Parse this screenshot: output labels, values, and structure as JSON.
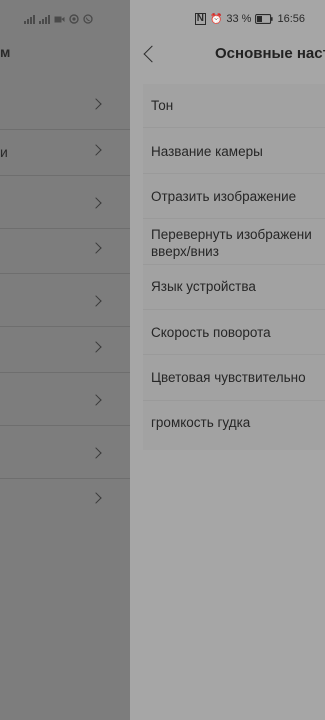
{
  "status_bar": {
    "left_icons": [
      "signal-icon",
      "signal-icon",
      "video-icon",
      "circle-icon",
      "whatsapp-icon"
    ],
    "nfc": "N",
    "alarm": "⏰",
    "battery_percent": "33 %",
    "time": "16:56"
  },
  "background": {
    "header_fragment": "м",
    "row_fragment": "и"
  },
  "sheet": {
    "title": "Основные наст",
    "items": [
      {
        "label": "Тон"
      },
      {
        "label": "Название камеры"
      },
      {
        "label": "Отразить изображение"
      },
      {
        "label": "Перевернуть изображени",
        "label2": "вверх/вниз"
      },
      {
        "label": "Язык устройства"
      },
      {
        "label": "Скорость поворота"
      },
      {
        "label": "Цветовая чувствительно"
      },
      {
        "label": "громкость гудка"
      }
    ]
  }
}
